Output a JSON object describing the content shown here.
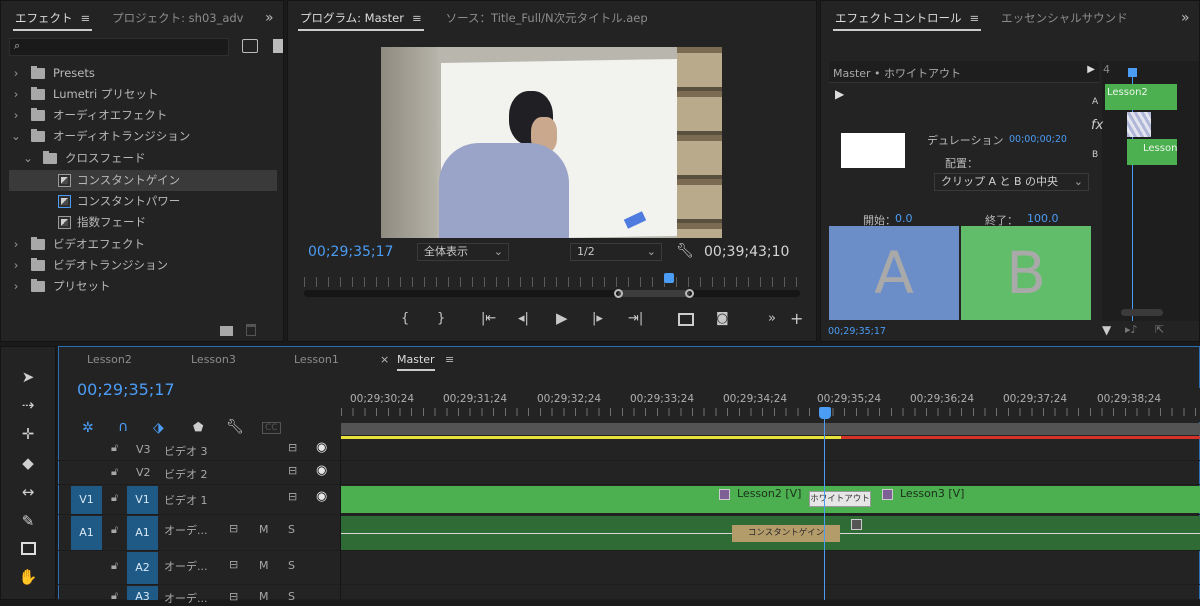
{
  "effects_panel": {
    "tab_effects": "エフェクト",
    "tab_project": "プロジェクト: sh03_adv",
    "items": [
      {
        "label": "Presets",
        "caret": "›"
      },
      {
        "label": "Lumetri プリセット",
        "caret": "›"
      },
      {
        "label": "オーディオエフェクト",
        "caret": "›"
      },
      {
        "label": "オーディオトランジション",
        "caret": "⌄"
      },
      {
        "label": "クロスフェード",
        "caret": "⌄"
      },
      {
        "label": "コンスタントゲイン",
        "caret": ""
      },
      {
        "label": "コンスタントパワー",
        "caret": ""
      },
      {
        "label": "指数フェード",
        "caret": ""
      },
      {
        "label": "ビデオエフェクト",
        "caret": "›"
      },
      {
        "label": "ビデオトランジション",
        "caret": "›"
      },
      {
        "label": "プリセット",
        "caret": "›"
      }
    ]
  },
  "program_monitor": {
    "tab_program": "プログラム: Master",
    "tab_source": "ソース：Title_Full/N次元タイトル.aep",
    "current_time": "00;29;35;17",
    "zoom_value": "全体表示",
    "resolution_value": "1/2",
    "duration_time": "00;39;43;10"
  },
  "effect_controls": {
    "tab_effect_controls": "エフェクトコントロール",
    "tab_essential_sound": "エッセンシャルサウンド",
    "clip_header": "Master • ホワイトアウト",
    "mini_ruler_label": "4",
    "clip_lesson2": "Lesson2",
    "clip_lesson_b": "Lesson",
    "track_a": "A",
    "track_b": "B",
    "fx_label": "fx",
    "duration_label": "デュレーション",
    "duration_value": "00;00;00;20",
    "alignment_label": "配置：",
    "alignment_value": "クリップ A と B の中央",
    "start_label": "開始：",
    "start_value": "0.0",
    "end_label": "終了：",
    "end_value": "100.0",
    "preview_a": "A",
    "preview_b": "B",
    "footer_time": "00;29;35;17"
  },
  "timeline": {
    "tabs": [
      {
        "label": "Lesson2"
      },
      {
        "label": "Lesson3"
      },
      {
        "label": "Lesson1"
      },
      {
        "label": "Master"
      }
    ],
    "close_glyph": "×",
    "current_time": "00;29;35;17",
    "ruler_labels": [
      "00;29;30;24",
      "00;29;31;24",
      "00;29;32;24",
      "00;29;33;24",
      "00;29;34;24",
      "00;29;35;24",
      "00;29;36;24",
      "00;29;37;24",
      "00;29;38;24"
    ],
    "tracks": [
      {
        "id": "V3",
        "name": "ビデオ 3"
      },
      {
        "id": "V2",
        "name": "ビデオ 2"
      },
      {
        "id": "V1",
        "name": "ビデオ 1",
        "src": "V1"
      },
      {
        "id": "A1",
        "name": "オーデ...",
        "src": "A1"
      },
      {
        "id": "A2",
        "name": "オーデ..."
      },
      {
        "id": "A3",
        "name": "オーデ..."
      }
    ],
    "mute": "M",
    "solo": "S",
    "clip_lesson2_video": "Lesson2 [V]",
    "clip_lesson3_video": "Lesson3 [V]",
    "transition_whiteout": "ホワイトアウト",
    "transition_constant_gain": "コンスタントゲイン",
    "cc_label": "CC"
  },
  "colors": {
    "timecode_blue": "#4b9cf5",
    "video_clip_green": "#4caf50",
    "audio_clip_green": "#2f6b34",
    "work_area_yellow": "#e8e23a",
    "render_red": "#d4332a",
    "preview_a_blue": "#6b8ec9",
    "preview_b_green": "#62bd6b"
  }
}
